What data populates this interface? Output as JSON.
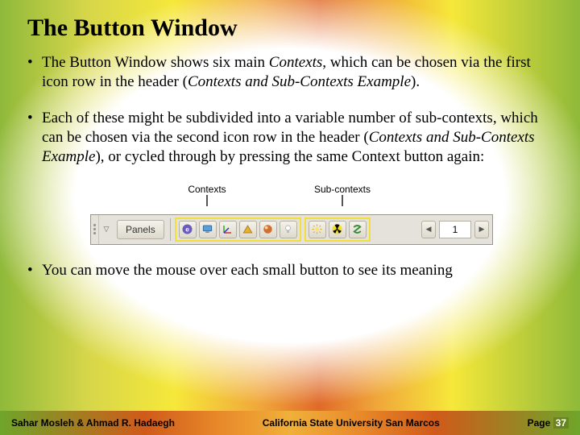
{
  "title": "The Button Window",
  "bullets": {
    "b1a": "The Button Window shows six main ",
    "b1b": "Contexts",
    "b1c": ", which can be chosen via the first icon row in the header (",
    "b1d": "Contexts and Sub-Contexts Example",
    "b1e": ").",
    "b2a": "Each of these might be subdivided into a variable number of sub-contexts, which can be chosen via the second icon row in the header (",
    "b2b": "Contexts and Sub-Contexts Example",
    "b2c": "), or cycled through by pressing the same Context button again:",
    "b3": "You can move the mouse over each small button to see its meaning"
  },
  "toolbar": {
    "callout_contexts": "Contexts",
    "callout_subcontexts": "Sub-contexts",
    "panels_label": "Panels",
    "spinner_value": "1"
  },
  "footer": {
    "authors": "Sahar Mosleh & Ahmad R. Hadaegh",
    "institution": "California State University San Marcos",
    "page_label": "Page",
    "page_number": "37"
  }
}
